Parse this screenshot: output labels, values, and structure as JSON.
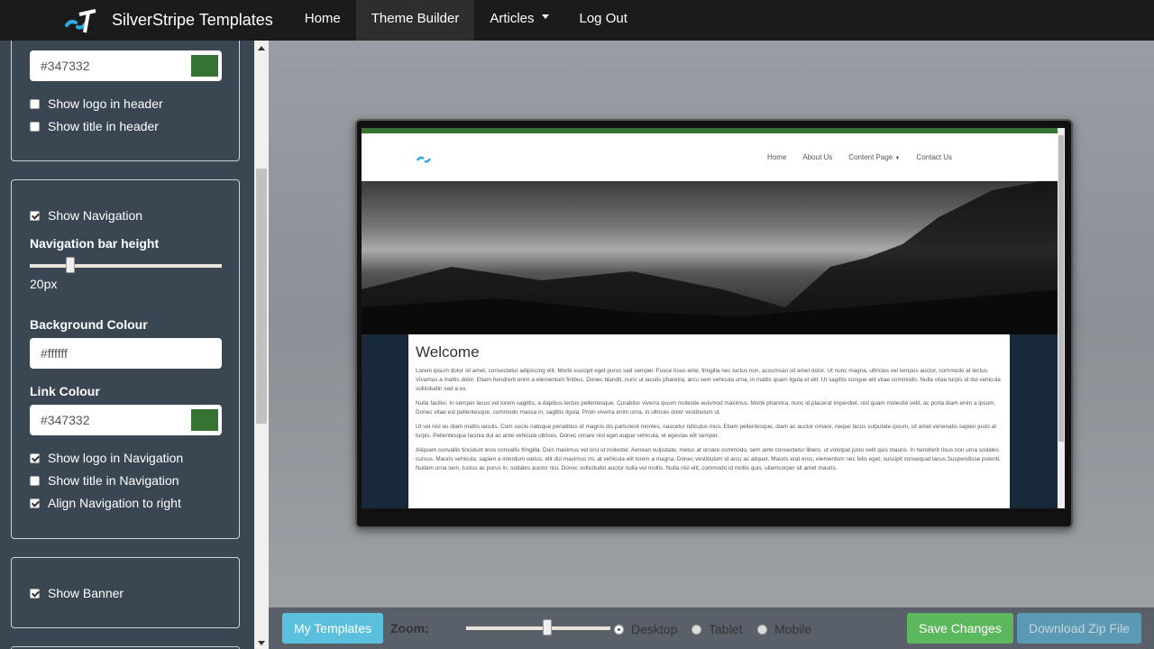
{
  "topbar": {
    "brand": "SilverStripe Templates",
    "nav": [
      {
        "label": "Home"
      },
      {
        "label": "Theme Builder",
        "active": true
      },
      {
        "label": "Articles",
        "dropdown": true
      },
      {
        "label": "Log Out"
      }
    ]
  },
  "sidebar": {
    "panel1": {
      "colour_value": "#347332",
      "swatch": "#347332",
      "checkboxes": [
        {
          "label": "Show logo in header",
          "checked": false
        },
        {
          "label": "Show title in header",
          "checked": false
        }
      ]
    },
    "panel2": {
      "show_navigation": {
        "label": "Show Navigation",
        "checked": true
      },
      "nav_height_label": "Navigation bar height",
      "nav_height_value": "20px",
      "nav_height_fraction": 0.2,
      "bg_label": "Background Colour",
      "bg_value": "#ffffff",
      "link_label": "Link Colour",
      "link_value": "#347332",
      "link_swatch": "#347332",
      "checkboxes": [
        {
          "label": "Show logo in Navigation",
          "checked": true
        },
        {
          "label": "Show title in Navigation",
          "checked": false
        },
        {
          "label": "Align Navigation to right",
          "checked": true
        }
      ]
    },
    "panel3": {
      "show_banner": {
        "label": "Show Banner",
        "checked": true
      }
    }
  },
  "preview": {
    "nav": [
      "Home",
      "About Us",
      "Content Page",
      "Contact Us"
    ],
    "title": "Welcome",
    "paragraphs": [
      "Lorem ipsum dolor sit amet, consectetur adipiscing elit. Morbi suscipit eget purus sed semper. Fusce risus ante, fringilla nec luctus non, accumsan sit amet dolor. Ut nunc magna, ultricies vel tempus auctor, commodo at lectus. Vivamus a mattis dolor. Etiam hendrerit enim a elementum finibus. Donec blandit, nunc ut iaculis pharetra, arcu sem vehicula urna, in mattis quam ligula et elit. Ut sagittis congue elit vitae commodo. Nulla vitae turpis id dui vehicula sollicitudin sed a ex.",
      "Nulla facilisi. In semper lacus vel lorem sagittis, a dapibus lectus pellentesque. Curabitur viverra ipsum molestie euismod maximus. Morbi pharetra, nunc id placerat imperdiet, nisl quam molestie velit, ac porta diam enim a ipsum. Donec vitae est pellentesque, commodo massa in, sagittis ligula. Proin viverra enim urna, in ultrices dolor vestibulum ut.",
      "Ut vel nisl eu diam mattis iaculis. Cum sociis natoque penatibus et magnis dis parturient montes, nascetur ridiculus mus. Etiam pellentesque, diam ac auctor ornare, neque lacus vulputate ipsum, sit amet venenatis sapien justo at turpis. Pellentesque lacinia dui ac ante vehicula ultrices. Donec ornare nisl eget augue vehicula, et egestas elit semper.",
      "Aliquam convallis tincidunt eros convallis fringilla. Duis maximus vel orci ut molestie. Aenean vulputate, metus at ornare commodo, sem ante consectetur libero, ut volutpat justo velit quis mauris. In hendrerit risus non urna sodales cursus. Mauris vehicula, sapien a interdum varius, elit dui maximus mi, at vehicula elit lorem a magna. Donec vestibulum id arcu ac aliquet. Mauris erat eros, elementum nec felis eget, suscipit consequat lacus.Suspendisse potenti. Nullam urna sem, luctus ac purus in, sodales auctor nisi. Donec sollicitudin auctor nulla vel mollis. Nulla nisl elit, commodo id mollis quis, ullamcorper sit amet mauris."
    ]
  },
  "bottombar": {
    "my_templates": "My Templates",
    "zoom_label": "Zoom:",
    "zoom_fraction": 0.56,
    "devices": [
      {
        "label": "Desktop",
        "selected": true
      },
      {
        "label": "Tablet",
        "selected": false
      },
      {
        "label": "Mobile",
        "selected": false
      }
    ],
    "save": "Save Changes",
    "download": "Download Zip File"
  },
  "colors": {
    "accent": "#347332",
    "save": "#5cb85c",
    "info": "#5bc0de",
    "download": "#5a9ab5"
  }
}
